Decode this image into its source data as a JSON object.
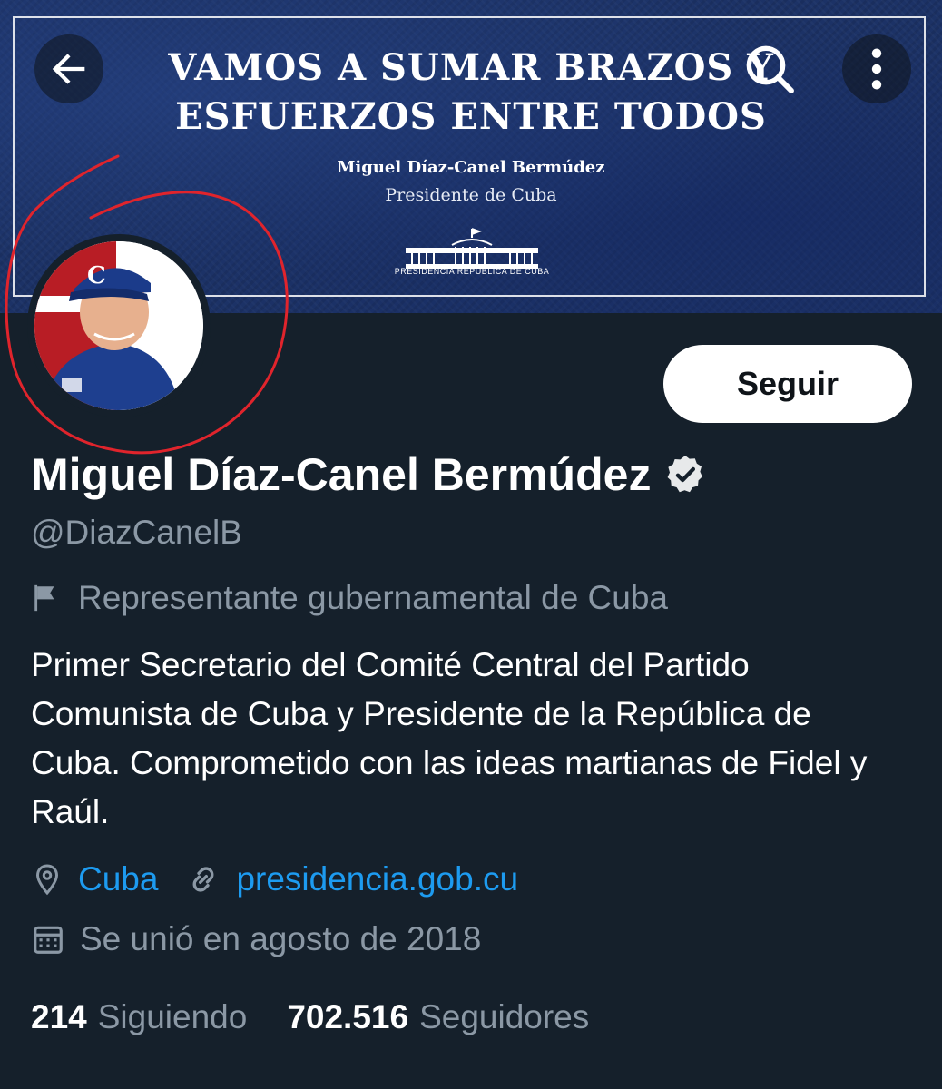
{
  "banner": {
    "headline_line1": "VAMOS A SUMAR BRAZOS Y",
    "headline_line2": "ESFUERZOS ENTRE TODOS",
    "name": "Miguel Díaz-Canel Bermúdez",
    "role": "Presidente de Cuba",
    "logo_text": "PRESIDENCIA REPÚBLICA DE CUBA"
  },
  "header": {
    "back_icon": "arrow-left-icon",
    "search_icon": "search-icon",
    "more_icon": "more-vertical-icon"
  },
  "profile": {
    "display_name": "Miguel Díaz-Canel Bermúdez",
    "handle": "@DiazCanelB",
    "follow_label": "Seguir",
    "gov_label": "Representante gubernamental de Cuba",
    "bio": "Primer Secretario del Comité Central del Partido Comunista de Cuba y Presidente de la República de Cuba. Comprometido con las ideas martianas de Fidel y Raúl.",
    "location": "Cuba",
    "website": "presidencia.gob.cu",
    "joined": "Se unió en agosto de 2018"
  },
  "stats": {
    "following_count": "214",
    "following_label": "Siguiendo",
    "followers_count": "702.516",
    "followers_label": "Seguidores"
  },
  "colors": {
    "background": "#15202b",
    "accent": "#1d9bf0",
    "muted": "#8b98a5",
    "annotation": "#e0242c"
  }
}
